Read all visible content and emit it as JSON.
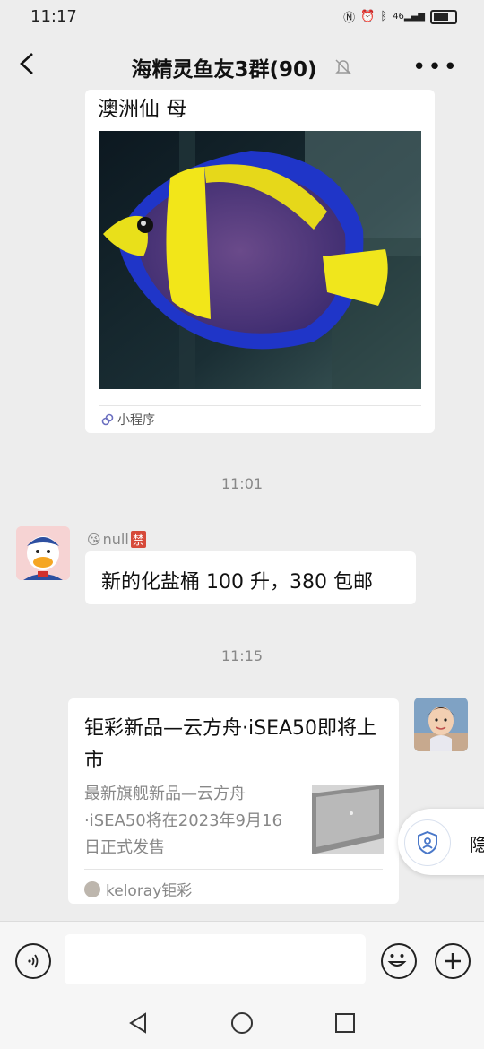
{
  "status_bar": {
    "time": "11:17",
    "signal": "46"
  },
  "header": {
    "title": "海精灵鱼友3群(90)"
  },
  "card_partial": {
    "title_fragment": "澳洲仙 母",
    "footer": "小程序"
  },
  "timestamps": [
    "11:01",
    "11:15"
  ],
  "message1": {
    "sender": "null",
    "ban_badge": "禁",
    "text": "新的化盐桶 100 升，380 包邮"
  },
  "link_card": {
    "title": "钜彩新品—云方舟·iSEA50即将上市",
    "description": "最新旗舰新品—云方舟·iSEA50将在2023年9月16日正式发售",
    "source": "keloray钜彩"
  },
  "float_panel": {
    "label": "隐"
  },
  "input_bar": {
    "placeholder": ""
  }
}
